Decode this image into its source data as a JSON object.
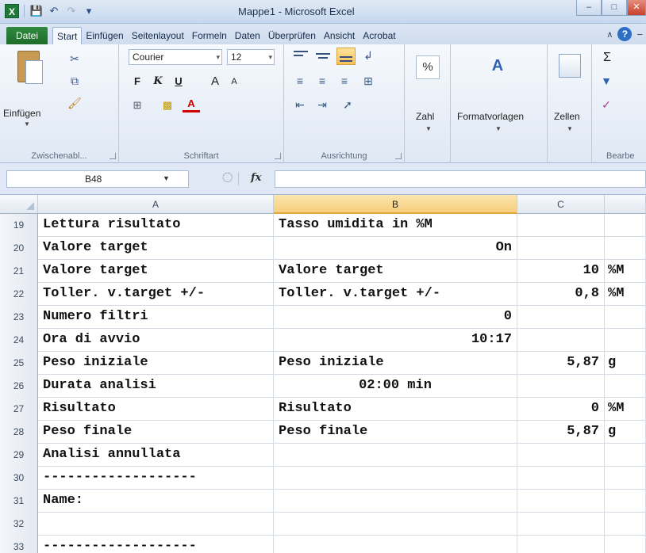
{
  "window": {
    "title": "Mappe1 - Microsoft Excel",
    "icons": [
      "excel-logo",
      "save-icon",
      "undo-icon",
      "redo-icon",
      "customize-qat-icon"
    ],
    "controls": [
      "minimize",
      "maximize",
      "close"
    ]
  },
  "ribbon_tabs": [
    {
      "label": "Datei"
    },
    {
      "label": "Start"
    },
    {
      "label": "Einfügen"
    },
    {
      "label": "Seitenlayout"
    },
    {
      "label": "Formeln"
    },
    {
      "label": "Daten"
    },
    {
      "label": "Überprüfen"
    },
    {
      "label": "Ansicht"
    },
    {
      "label": "Acrobat"
    }
  ],
  "ribbon": {
    "clipboard": {
      "paste_label": "Einfügen",
      "group_label": "Zwischenabl..."
    },
    "font": {
      "name": "Courier",
      "size": "12",
      "bold": "F",
      "italic": "K",
      "underline": "U",
      "grow": "A",
      "shrink": "A",
      "font_color_letter": "A",
      "group_label": "Schriftart"
    },
    "alignment": {
      "group_label": "Ausrichtung"
    },
    "number": {
      "label": "Zahl",
      "symbol": "%"
    },
    "styles": {
      "label": "Formatvorlagen",
      "symbol": "A"
    },
    "cells": {
      "label": "Zellen"
    },
    "editing": {
      "group_label": "Bearbe",
      "sigma": "Σ"
    }
  },
  "formula_bar": {
    "name_box": "B48",
    "fx": "fx",
    "formula": ""
  },
  "columns": [
    {
      "label": "",
      "selected": false
    },
    {
      "label": "A",
      "selected": false
    },
    {
      "label": "B",
      "selected": true
    },
    {
      "label": "C",
      "selected": false
    },
    {
      "label": "",
      "selected": false
    }
  ],
  "rows": [
    {
      "num": "19",
      "a": "Lettura risultato",
      "b": "Tasso umidita in %M",
      "c": "",
      "d": ""
    },
    {
      "num": "20",
      "a": "Valore target",
      "b": "On",
      "c": "",
      "d": ""
    },
    {
      "num": "21",
      "a": "Valore target",
      "b": "Valore target",
      "c": "10",
      "d": "%M"
    },
    {
      "num": "22",
      "a": "Toller. v.target +/-",
      "b": "Toller. v.target +/-",
      "c": "0,8",
      "d": "%M"
    },
    {
      "num": "23",
      "a": "Numero filtri",
      "b": "0",
      "c": "",
      "d": ""
    },
    {
      "num": "24",
      "a": "Ora di avvio",
      "b": "10:17",
      "c": "",
      "d": ""
    },
    {
      "num": "25",
      "a": "Peso iniziale",
      "b": "Peso iniziale",
      "c": "5,87",
      "d": "g"
    },
    {
      "num": "26",
      "a": "Durata analisi",
      "b": "02:00 min",
      "c": "",
      "d": ""
    },
    {
      "num": "27",
      "a": "Risultato",
      "b": "Risultato",
      "c": "0",
      "d": "%M"
    },
    {
      "num": "28",
      "a": "Peso finale",
      "b": "Peso finale",
      "c": "5,87",
      "d": "g"
    },
    {
      "num": "29",
      "a": "Analisi annullata",
      "b": "",
      "c": "",
      "d": ""
    },
    {
      "num": "30",
      "a": "-------------------",
      "b": "",
      "c": "",
      "d": ""
    },
    {
      "num": "31",
      "a": "Name:",
      "b": "",
      "c": "",
      "d": ""
    },
    {
      "num": "32",
      "a": "",
      "b": "",
      "c": "",
      "d": ""
    },
    {
      "num": "33",
      "a": "-------------------",
      "b": "",
      "c": "",
      "d": ""
    }
  ]
}
